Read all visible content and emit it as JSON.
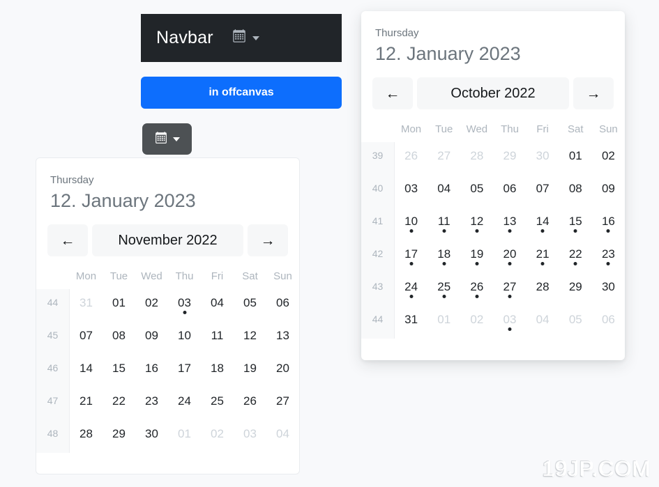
{
  "navbar": {
    "brand": "Navbar",
    "calendar_icon": "calendar-icon",
    "caret_icon": "chevron-down-icon"
  },
  "offcanvas_button": {
    "label": "in offcanvas"
  },
  "dropdown_button": {
    "calendar_icon": "calendar-icon",
    "caret_icon": "chevron-down-icon"
  },
  "calendars": [
    {
      "id": "calendar-inline",
      "selected_weekday": "Thursday",
      "selected_date": "12. January 2023",
      "prev_label": "←",
      "next_label": "→",
      "month_label": "November 2022",
      "weekdays": [
        "Mon",
        "Tue",
        "Wed",
        "Thu",
        "Fri",
        "Sat",
        "Sun"
      ],
      "weeks": [
        {
          "week_number": "44",
          "days": [
            {
              "label": "31",
              "muted": true,
              "dot": false
            },
            {
              "label": "01",
              "muted": false,
              "dot": false
            },
            {
              "label": "02",
              "muted": false,
              "dot": false
            },
            {
              "label": "03",
              "muted": false,
              "dot": true
            },
            {
              "label": "04",
              "muted": false,
              "dot": false
            },
            {
              "label": "05",
              "muted": false,
              "dot": false
            },
            {
              "label": "06",
              "muted": false,
              "dot": false
            }
          ]
        },
        {
          "week_number": "45",
          "days": [
            {
              "label": "07",
              "muted": false,
              "dot": false
            },
            {
              "label": "08",
              "muted": false,
              "dot": false
            },
            {
              "label": "09",
              "muted": false,
              "dot": false
            },
            {
              "label": "10",
              "muted": false,
              "dot": false
            },
            {
              "label": "11",
              "muted": false,
              "dot": false
            },
            {
              "label": "12",
              "muted": false,
              "dot": false
            },
            {
              "label": "13",
              "muted": false,
              "dot": false
            }
          ]
        },
        {
          "week_number": "46",
          "days": [
            {
              "label": "14",
              "muted": false,
              "dot": false
            },
            {
              "label": "15",
              "muted": false,
              "dot": false
            },
            {
              "label": "16",
              "muted": false,
              "dot": false
            },
            {
              "label": "17",
              "muted": false,
              "dot": false
            },
            {
              "label": "18",
              "muted": false,
              "dot": false
            },
            {
              "label": "19",
              "muted": false,
              "dot": false
            },
            {
              "label": "20",
              "muted": false,
              "dot": false
            }
          ]
        },
        {
          "week_number": "47",
          "days": [
            {
              "label": "21",
              "muted": false,
              "dot": false
            },
            {
              "label": "22",
              "muted": false,
              "dot": false
            },
            {
              "label": "23",
              "muted": false,
              "dot": false
            },
            {
              "label": "24",
              "muted": false,
              "dot": false
            },
            {
              "label": "25",
              "muted": false,
              "dot": false
            },
            {
              "label": "26",
              "muted": false,
              "dot": false
            },
            {
              "label": "27",
              "muted": false,
              "dot": false
            }
          ]
        },
        {
          "week_number": "48",
          "days": [
            {
              "label": "28",
              "muted": false,
              "dot": false
            },
            {
              "label": "29",
              "muted": false,
              "dot": false
            },
            {
              "label": "30",
              "muted": false,
              "dot": false
            },
            {
              "label": "01",
              "muted": true,
              "dot": false
            },
            {
              "label": "02",
              "muted": true,
              "dot": false
            },
            {
              "label": "03",
              "muted": true,
              "dot": false
            },
            {
              "label": "04",
              "muted": true,
              "dot": false
            }
          ]
        }
      ]
    },
    {
      "id": "calendar-popup",
      "selected_weekday": "Thursday",
      "selected_date": "12. January 2023",
      "prev_label": "←",
      "next_label": "→",
      "month_label": "October 2022",
      "weekdays": [
        "Mon",
        "Tue",
        "Wed",
        "Thu",
        "Fri",
        "Sat",
        "Sun"
      ],
      "weeks": [
        {
          "week_number": "39",
          "days": [
            {
              "label": "26",
              "muted": true,
              "dot": false
            },
            {
              "label": "27",
              "muted": true,
              "dot": false
            },
            {
              "label": "28",
              "muted": true,
              "dot": false
            },
            {
              "label": "29",
              "muted": true,
              "dot": false
            },
            {
              "label": "30",
              "muted": true,
              "dot": false
            },
            {
              "label": "01",
              "muted": false,
              "dot": false
            },
            {
              "label": "02",
              "muted": false,
              "dot": false
            }
          ]
        },
        {
          "week_number": "40",
          "days": [
            {
              "label": "03",
              "muted": false,
              "dot": false
            },
            {
              "label": "04",
              "muted": false,
              "dot": false
            },
            {
              "label": "05",
              "muted": false,
              "dot": false
            },
            {
              "label": "06",
              "muted": false,
              "dot": false
            },
            {
              "label": "07",
              "muted": false,
              "dot": false
            },
            {
              "label": "08",
              "muted": false,
              "dot": false
            },
            {
              "label": "09",
              "muted": false,
              "dot": false
            }
          ]
        },
        {
          "week_number": "41",
          "days": [
            {
              "label": "10",
              "muted": false,
              "dot": true
            },
            {
              "label": "11",
              "muted": false,
              "dot": true
            },
            {
              "label": "12",
              "muted": false,
              "dot": true
            },
            {
              "label": "13",
              "muted": false,
              "dot": true
            },
            {
              "label": "14",
              "muted": false,
              "dot": true
            },
            {
              "label": "15",
              "muted": false,
              "dot": true
            },
            {
              "label": "16",
              "muted": false,
              "dot": true
            }
          ]
        },
        {
          "week_number": "42",
          "days": [
            {
              "label": "17",
              "muted": false,
              "dot": true
            },
            {
              "label": "18",
              "muted": false,
              "dot": true
            },
            {
              "label": "19",
              "muted": false,
              "dot": true
            },
            {
              "label": "20",
              "muted": false,
              "dot": true
            },
            {
              "label": "21",
              "muted": false,
              "dot": true
            },
            {
              "label": "22",
              "muted": false,
              "dot": true
            },
            {
              "label": "23",
              "muted": false,
              "dot": true
            }
          ]
        },
        {
          "week_number": "43",
          "days": [
            {
              "label": "24",
              "muted": false,
              "dot": true
            },
            {
              "label": "25",
              "muted": false,
              "dot": true
            },
            {
              "label": "26",
              "muted": false,
              "dot": true
            },
            {
              "label": "27",
              "muted": false,
              "dot": true
            },
            {
              "label": "28",
              "muted": false,
              "dot": false
            },
            {
              "label": "29",
              "muted": false,
              "dot": false
            },
            {
              "label": "30",
              "muted": false,
              "dot": false
            }
          ]
        },
        {
          "week_number": "44",
          "days": [
            {
              "label": "31",
              "muted": false,
              "dot": false
            },
            {
              "label": "01",
              "muted": true,
              "dot": false
            },
            {
              "label": "02",
              "muted": true,
              "dot": false
            },
            {
              "label": "03",
              "muted": true,
              "dot": true
            },
            {
              "label": "04",
              "muted": true,
              "dot": false
            },
            {
              "label": "05",
              "muted": true,
              "dot": false
            },
            {
              "label": "06",
              "muted": true,
              "dot": false
            }
          ]
        }
      ]
    }
  ],
  "watermark": {
    "text": "19JP.COM"
  },
  "colors": {
    "navbar_bg": "#212529",
    "primary": "#0d6efd",
    "secondary": "#4d5154",
    "page_bg": "#f8f9fb",
    "muted_text": "#ced4da",
    "label_text": "#6c757d"
  }
}
